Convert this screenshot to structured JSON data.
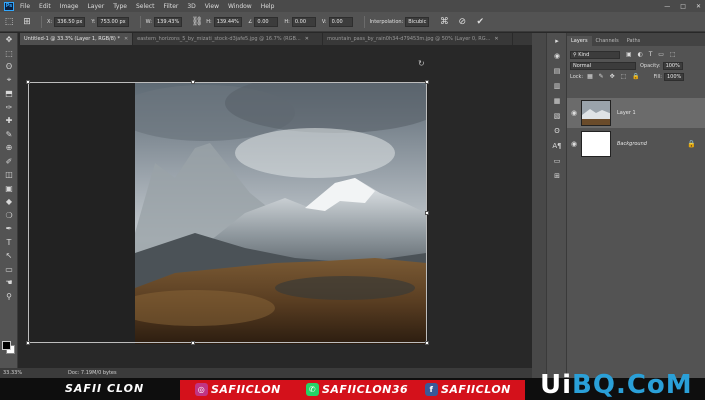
{
  "app": {
    "logo": "Ps"
  },
  "menu": [
    "File",
    "Edit",
    "Image",
    "Layer",
    "Type",
    "Select",
    "Filter",
    "3D",
    "View",
    "Window",
    "Help"
  ],
  "window_controls": [
    "—",
    "□",
    "✕"
  ],
  "options": {
    "x_label": "X:",
    "x_value": "336.50 px",
    "y_label": "Y:",
    "y_value": "753.00 px",
    "w_label": "W:",
    "w_value": "139.43%",
    "h_label": "H:",
    "h_value": "139.44%",
    "angle_label": "∠",
    "angle_value": "0.00",
    "hskew_label": "H:",
    "hskew_value": "0.00",
    "vskew_label": "V:",
    "vskew_value": "0.00",
    "interp_label": "Interpolation:",
    "interp_value": "Bicubic"
  },
  "tabs": [
    {
      "label": "Untitled-1 @ 33.3% (Layer 1, RGB/8) *",
      "active": true
    },
    {
      "label": "eastern_horizons_5_by_mizati_stock-d3jafe5.jpg @ 16.7% (RGB...",
      "active": false
    },
    {
      "label": "mountain_pass_by_rain0h34-d79453m.jpg @ 50% (Layer 0, RG...",
      "active": false
    }
  ],
  "tools": [
    "✥",
    "⬚",
    "ʘ",
    "⌖",
    "⬒",
    "✑",
    "✚",
    "✎",
    "⊕",
    "✐",
    "◫",
    "▣",
    "◆",
    "❍",
    "✒",
    "T",
    "↖",
    "▭",
    "☚",
    "⚲"
  ],
  "canvas": {
    "rotate_icon": "↻"
  },
  "status": {
    "zoom": "33.33%",
    "doc": "Doc: 7.19M/0 bytes"
  },
  "dock_icons": [
    "▸",
    "◉",
    "▤",
    "▥",
    "▦",
    "▧",
    "ʘ",
    "A¶",
    "▭",
    "⊞"
  ],
  "panel": {
    "tabs": [
      "Layers",
      "Channels",
      "Paths"
    ],
    "kind_placeholder": "Kind",
    "blend_mode": "Normal",
    "opacity_label": "Opacity:",
    "opacity_value": "100%",
    "lock_label": "Lock:",
    "fill_label": "Fill:",
    "fill_value": "100%",
    "layers": [
      {
        "name": "Layer 1",
        "selected": true
      },
      {
        "name": "Background",
        "selected": false,
        "locked": true
      }
    ]
  },
  "banner": {
    "left_name": "SAFII CLON",
    "instagram": "SAFIICLON",
    "whatsapp": "SAFIICLON36",
    "facebook": "SAFIICLON",
    "watermark_a": "Ui",
    "watermark_b": "BQ.CoM"
  }
}
